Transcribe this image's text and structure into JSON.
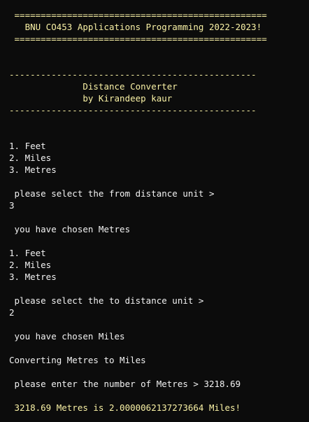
{
  "colors": {
    "background": "#0c0c0c",
    "banner_text": "#f9f1a5",
    "normal_text": "#f2f2f2"
  },
  "header": {
    "rule_top": " ================================================",
    "title": "   BNU CO453 Applications Programming 2022-2023!",
    "rule_bottom": " ================================================"
  },
  "app_banner": {
    "rule_top": "-----------------------------------------------",
    "app_name": "              Distance Converter",
    "author": "              by Kirandeep kaur",
    "rule_bottom": "-----------------------------------------------"
  },
  "from_menu": {
    "options": [
      "1. Feet",
      "2. Miles",
      "3. Metres"
    ],
    "prompt": " please select the from distance unit >",
    "input": "3",
    "confirmation": " you have chosen Metres"
  },
  "to_menu": {
    "options": [
      "1. Feet",
      "2. Miles",
      "3. Metres"
    ],
    "prompt": " please select the to distance unit >",
    "input": "2",
    "confirmation": " you have chosen Miles"
  },
  "conversion": {
    "heading": "Converting Metres to Miles",
    "amount_prompt": " please enter the number of Metres > 3218.69",
    "result": " 3218.69 Metres is 2.0000062137273664 Miles!"
  }
}
